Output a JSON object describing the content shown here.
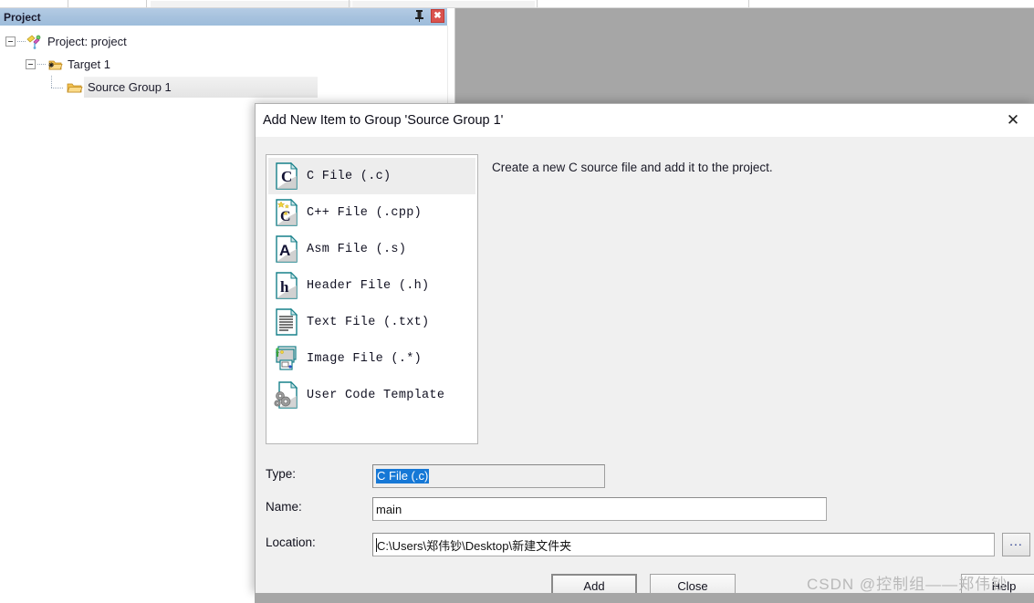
{
  "project_panel": {
    "title": "Project",
    "pin_icon": "pin-icon",
    "close_icon": "close-icon",
    "tree": [
      {
        "label": "Project: project",
        "level": 1,
        "icon": "project-icon",
        "expanded": true,
        "selected": false
      },
      {
        "label": "Target 1",
        "level": 2,
        "icon": "target-icon",
        "expanded": true,
        "selected": false
      },
      {
        "label": "Source Group 1",
        "level": 3,
        "icon": "folder-icon",
        "expanded": null,
        "selected": true
      }
    ]
  },
  "dialog": {
    "title": "Add New Item to Group 'Source Group 1'",
    "close_label": "✕",
    "description": "Create a new C source file and add it to the project.",
    "file_types": [
      {
        "label": "C File (.c)",
        "icon": "c-file-icon",
        "selected": true
      },
      {
        "label": "C++ File (.cpp)",
        "icon": "cpp-file-icon",
        "selected": false
      },
      {
        "label": "Asm File (.s)",
        "icon": "asm-file-icon",
        "selected": false
      },
      {
        "label": "Header File (.h)",
        "icon": "header-file-icon",
        "selected": false
      },
      {
        "label": "Text File (.txt)",
        "icon": "text-file-icon",
        "selected": false
      },
      {
        "label": "Image File (.*)",
        "icon": "image-file-icon",
        "selected": false
      },
      {
        "label": "User Code Template",
        "icon": "user-code-template-icon",
        "selected": false
      }
    ],
    "fields": {
      "type_label": "Type:",
      "type_value": "C File (.c)",
      "name_label": "Name:",
      "name_value": "main",
      "location_label": "Location:",
      "location_value": "C:\\Users\\郑伟钞\\Desktop\\新建文件夹",
      "browse_label": "..."
    },
    "buttons": {
      "add": "Add",
      "close": "Close",
      "help": "Help"
    }
  },
  "watermark": "CSDN @控制组——郑伟钞",
  "colors": {
    "panel_title_bg": "#a7c2de",
    "close_button_bg": "#d9534f",
    "selection_blue": "#1678d6",
    "editor_bg": "#a6a6a6",
    "dialog_bg": "#f0f0f0"
  }
}
